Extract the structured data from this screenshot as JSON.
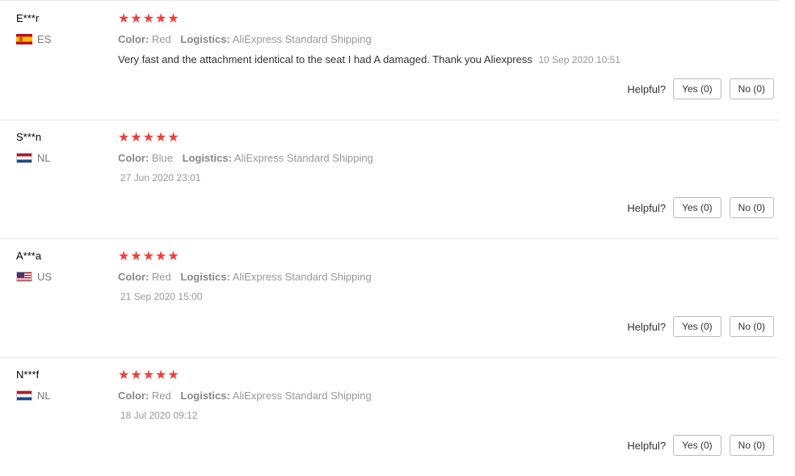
{
  "labels": {
    "color": "Color:",
    "logistics": "Logistics:",
    "helpful": "Helpful?"
  },
  "stars_glyph": "★★★★★",
  "reviews": [
    {
      "user": "E***r",
      "country": "ES",
      "rating": 5,
      "color": "Red",
      "logistics": "AliExpress Standard Shipping",
      "content": "Very fast and the attachment identical to the seat I had A damaged. Thank you Aliexpress",
      "date": "10 Sep 2020 10:51",
      "yes": "Yes (0)",
      "no": "No (0)"
    },
    {
      "user": "S***n",
      "country": "NL",
      "rating": 5,
      "color": "Blue",
      "logistics": "AliExpress Standard Shipping",
      "content": "",
      "date": "27 Jun 2020 23:01",
      "yes": "Yes (0)",
      "no": "No (0)"
    },
    {
      "user": "A***a",
      "country": "US",
      "rating": 5,
      "color": "Red",
      "logistics": "AliExpress Standard Shipping",
      "content": "",
      "date": "21 Sep 2020 15:00",
      "yes": "Yes (0)",
      "no": "No (0)"
    },
    {
      "user": "N***f",
      "country": "NL",
      "rating": 5,
      "color": "Red",
      "logistics": "AliExpress Standard Shipping",
      "content": "",
      "date": "18 Jul 2020 09:12",
      "yes": "Yes (0)",
      "no": "No (0)"
    }
  ],
  "colors": {
    "star": "#f23d3d",
    "divider": "#e8e8e8"
  }
}
